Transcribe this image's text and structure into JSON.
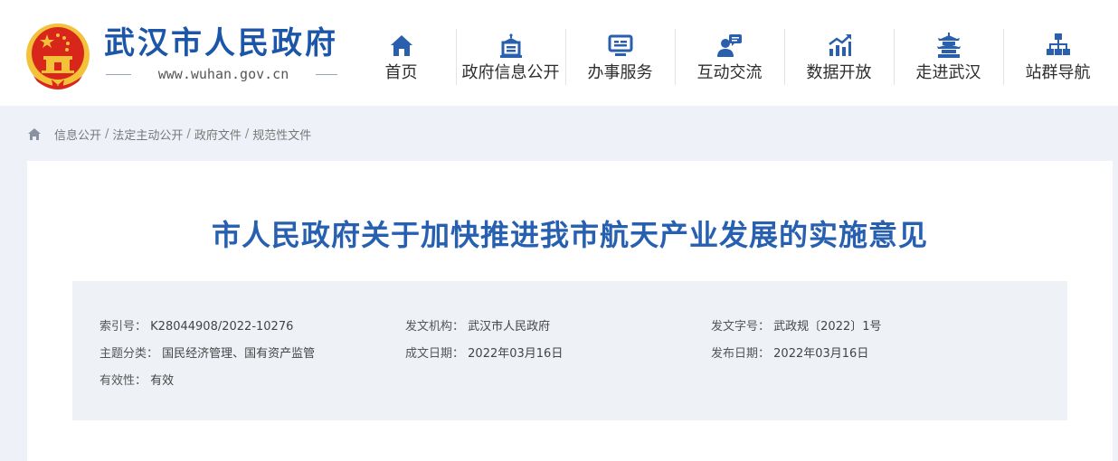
{
  "header": {
    "site_name": "武汉市人民政府",
    "site_url": "www.wuhan.gov.cn",
    "emblem_icon": "national-emblem-icon"
  },
  "nav": [
    {
      "label": "首页",
      "icon": "home-icon"
    },
    {
      "label": "政府信息公开",
      "icon": "government-building-icon"
    },
    {
      "label": "办事服务",
      "icon": "monitor-service-icon"
    },
    {
      "label": "互动交流",
      "icon": "user-chat-icon"
    },
    {
      "label": "数据开放",
      "icon": "bar-chart-trend-icon"
    },
    {
      "label": "走进武汉",
      "icon": "pavilion-tower-icon"
    },
    {
      "label": "站群导航",
      "icon": "sitemap-icon"
    }
  ],
  "breadcrumb": {
    "home_icon": "home-icon",
    "items": [
      "信息公开",
      "法定主动公开",
      "政府文件",
      "规范性文件"
    ],
    "separator": "/"
  },
  "article": {
    "title": "市人民政府关于加快推进我市航天产业发展的实施意见",
    "meta": {
      "index_label": "索引号：",
      "index_value": "K28044908/2022-10276",
      "issuer_label": "发文机构：",
      "issuer_value": "武汉市人民政府",
      "doc_no_label": "发文字号：",
      "doc_no_value": "武政规〔2022〕1号",
      "topic_label": "主题分类：",
      "topic_value": "国民经济管理、国有资产监管",
      "written_label": "成文日期：",
      "written_value": "2022年03月16日",
      "published_label": "发布日期：",
      "published_value": "2022年03月16日",
      "validity_label": "有效性：",
      "validity_value": "有效"
    }
  },
  "colors": {
    "brand_blue": "#1c56a8",
    "title_blue": "#2760b0",
    "icon_blue": "#2a5fae",
    "page_bg": "#eef2f8",
    "meta_bg": "#eef1f6",
    "emblem_red": "#d8261b",
    "emblem_gold": "#f2c23a"
  }
}
